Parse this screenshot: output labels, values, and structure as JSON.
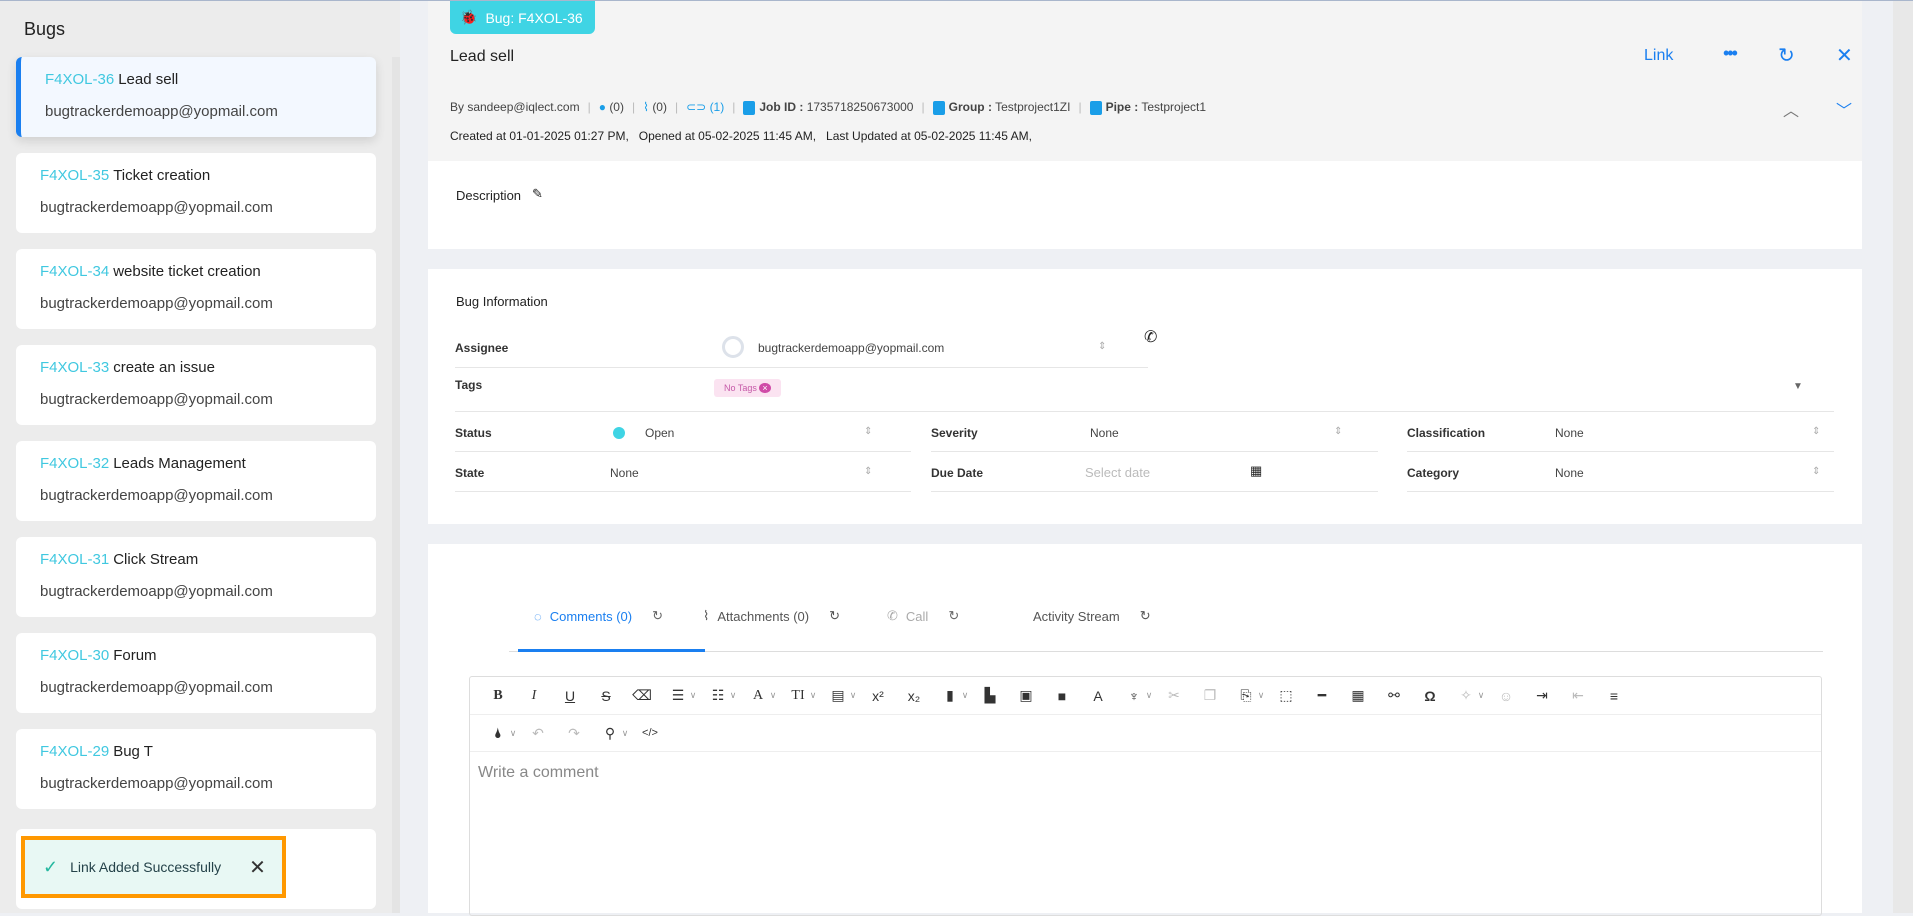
{
  "sidebar": {
    "title": "Bugs",
    "items": [
      {
        "id": "F4XOL-36",
        "title": "Lead sell",
        "email": "bugtrackerdemoapp@yopmail.com",
        "active": true
      },
      {
        "id": "F4XOL-35",
        "title": "Ticket creation",
        "email": "bugtrackerdemoapp@yopmail.com"
      },
      {
        "id": "F4XOL-34",
        "title": "website ticket creation",
        "email": "bugtrackerdemoapp@yopmail.com"
      },
      {
        "id": "F4XOL-33",
        "title": "create an issue",
        "email": "bugtrackerdemoapp@yopmail.com"
      },
      {
        "id": "F4XOL-32",
        "title": "Leads Management",
        "email": "bugtrackerdemoapp@yopmail.com"
      },
      {
        "id": "F4XOL-31",
        "title": "Click Stream",
        "email": "bugtrackerdemoapp@yopmail.com"
      },
      {
        "id": "F4XOL-30",
        "title": "Forum",
        "email": "bugtrackerdemoapp@yopmail.com"
      },
      {
        "id": "F4XOL-29",
        "title": "Bug T",
        "email": "bugtrackerdemoapp@yopmail.com"
      }
    ]
  },
  "toast": {
    "message": "Link Added Successfully",
    "icon": "check-circle-icon",
    "color": "#26b8a0"
  },
  "header": {
    "badge": "Bug: F4XOL-36",
    "title": "Lead sell",
    "link_label": "Link",
    "by": "By sandeep@iqlect.com",
    "comments_count": "(0)",
    "attachments_count": "(0)",
    "links_count": "(1)",
    "job_label": "Job ID :",
    "job_id": "1735718250673000",
    "group_label": "Group :",
    "group": "Testproject1ZI",
    "pipe_label": "Pipe :",
    "pipe": "Testproject1",
    "dates": "Created at 01-01-2025 01:27 PM,   Opened at 05-02-2025 11:45 AM,   Last Updated at 05-02-2025 11:45 AM,"
  },
  "description": {
    "label": "Description"
  },
  "bug_info": {
    "title": "Bug Information",
    "assignee_label": "Assignee",
    "assignee": "bugtrackerdemoapp@yopmail.com",
    "tags_label": "Tags",
    "tag": "No Tags",
    "status_label": "Status",
    "status": "Open",
    "status_color": "#3fd4e4",
    "severity_label": "Severity",
    "severity": "None",
    "classification_label": "Classification",
    "classification": "None",
    "state_label": "State",
    "state": "None",
    "due_label": "Due Date",
    "due_placeholder": "Select date",
    "category_label": "Category",
    "category": "None"
  },
  "tabs": [
    {
      "label": "Comments (0)"
    },
    {
      "label": "Attachments (0)"
    },
    {
      "label": "Call"
    },
    {
      "label": "Activity Stream"
    }
  ],
  "editor": {
    "placeholder": "Write a comment"
  },
  "accent": "#1a7ff0"
}
